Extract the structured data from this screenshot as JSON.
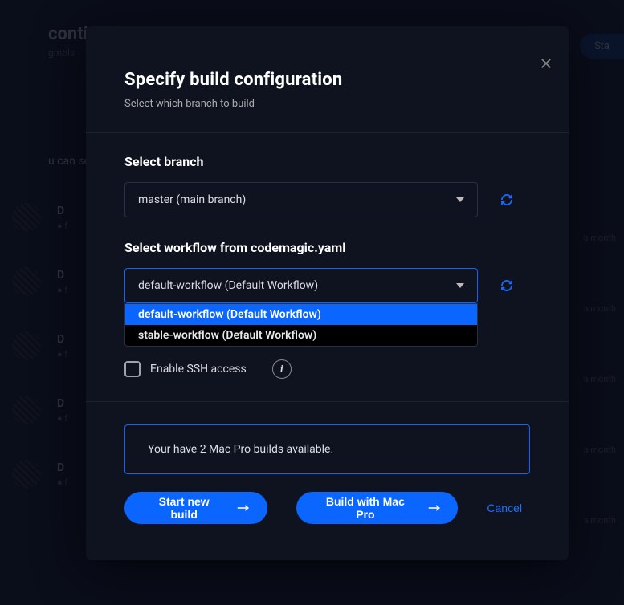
{
  "bg": {
    "logo": "continual",
    "sub": "gmbls",
    "line": "u can see all the",
    "row_label": "D",
    "start": "Sta",
    "time": "a month"
  },
  "modal": {
    "title": "Specify build configuration",
    "subtitle": "Select which branch to build"
  },
  "branch": {
    "label": "Select branch",
    "selected": "master (main branch)"
  },
  "workflow": {
    "label": "Select workflow from codemagic.yaml",
    "selected": "default-workflow (Default Workflow)",
    "options": [
      "default-workflow (Default Workflow)",
      "stable-workflow (Default Workflow)"
    ]
  },
  "ssh": {
    "label": "Enable SSH access"
  },
  "notice": "Your have 2 Mac Pro builds available.",
  "buttons": {
    "start": "Start new build",
    "macpro": "Build with Mac Pro",
    "cancel": "Cancel"
  }
}
